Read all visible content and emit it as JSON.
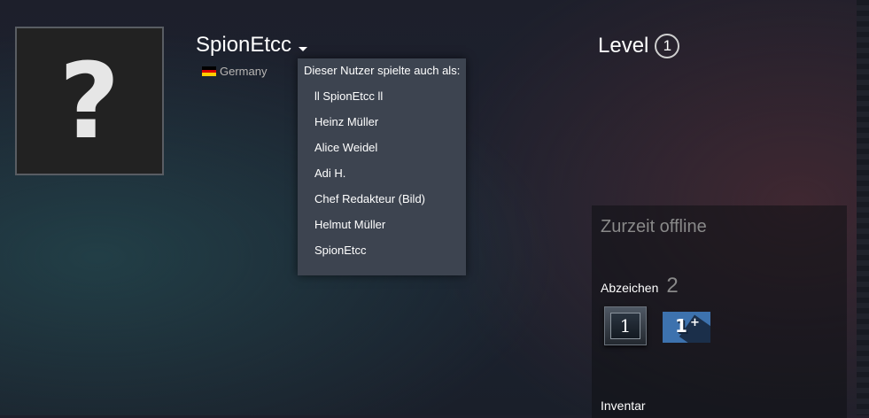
{
  "profile": {
    "avatar_glyph": "?",
    "persona_name": "SpionEtcc",
    "country": "Germany",
    "flag_colors": [
      "#000000",
      "#dd0000",
      "#ffce00"
    ]
  },
  "alias_dropdown": {
    "header": "Dieser Nutzer spielte auch als:",
    "aliases": [
      "ll SpionEtcc ll",
      "Heinz Müller",
      "Alice Weidel",
      "Adi H.",
      "Chef Redakteur (Bild)",
      "Helmut Müller",
      "SpionEtcc"
    ]
  },
  "level": {
    "label": "Level",
    "value": "1"
  },
  "status_panel": {
    "status": "Zurzeit offline",
    "badges_label": "Abzeichen",
    "badges_count": "2",
    "badges": [
      {
        "text": "1",
        "name": "years-of-service-badge"
      },
      {
        "text": "1",
        "plus": "+",
        "name": "community-badge"
      }
    ],
    "inventory_label": "Inventar"
  }
}
